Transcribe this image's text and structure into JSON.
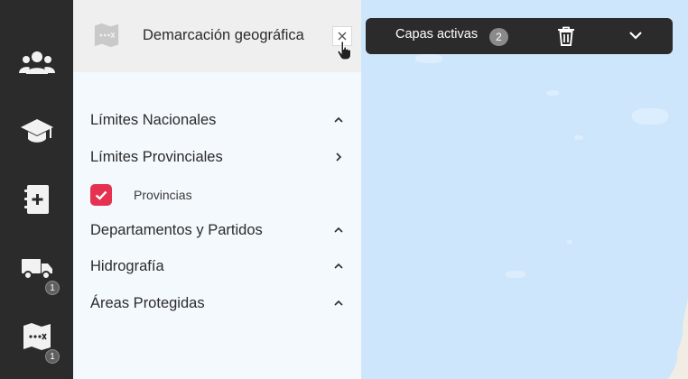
{
  "panel": {
    "title": "Demarcación geográfica"
  },
  "rail": {
    "items": [
      {
        "icon": "users-icon"
      },
      {
        "icon": "graduation-cap-icon"
      },
      {
        "icon": "notebook-plus-icon"
      },
      {
        "icon": "truck-icon",
        "badge": "1"
      },
      {
        "icon": "map-icon",
        "badge": "1"
      }
    ]
  },
  "groups": [
    {
      "label": "Límites Nacionales",
      "chevron": "up"
    },
    {
      "label": "Límites Provinciales",
      "chevron": "right"
    },
    {
      "label": "Departamentos y Partidos",
      "chevron": "up"
    },
    {
      "label": "Hidrografía",
      "chevron": "up"
    },
    {
      "label": "Áreas Protegidas",
      "chevron": "up"
    }
  ],
  "subitems": [
    {
      "label": "Provincias",
      "checked": true
    }
  ],
  "layers_bar": {
    "label": "Capas activas",
    "count": "2"
  },
  "colors": {
    "rail": "#2b2b2b",
    "panel": "#f4f9fe",
    "header": "#efefef",
    "accent": "#e53251",
    "map_water": "#cde6fb"
  }
}
